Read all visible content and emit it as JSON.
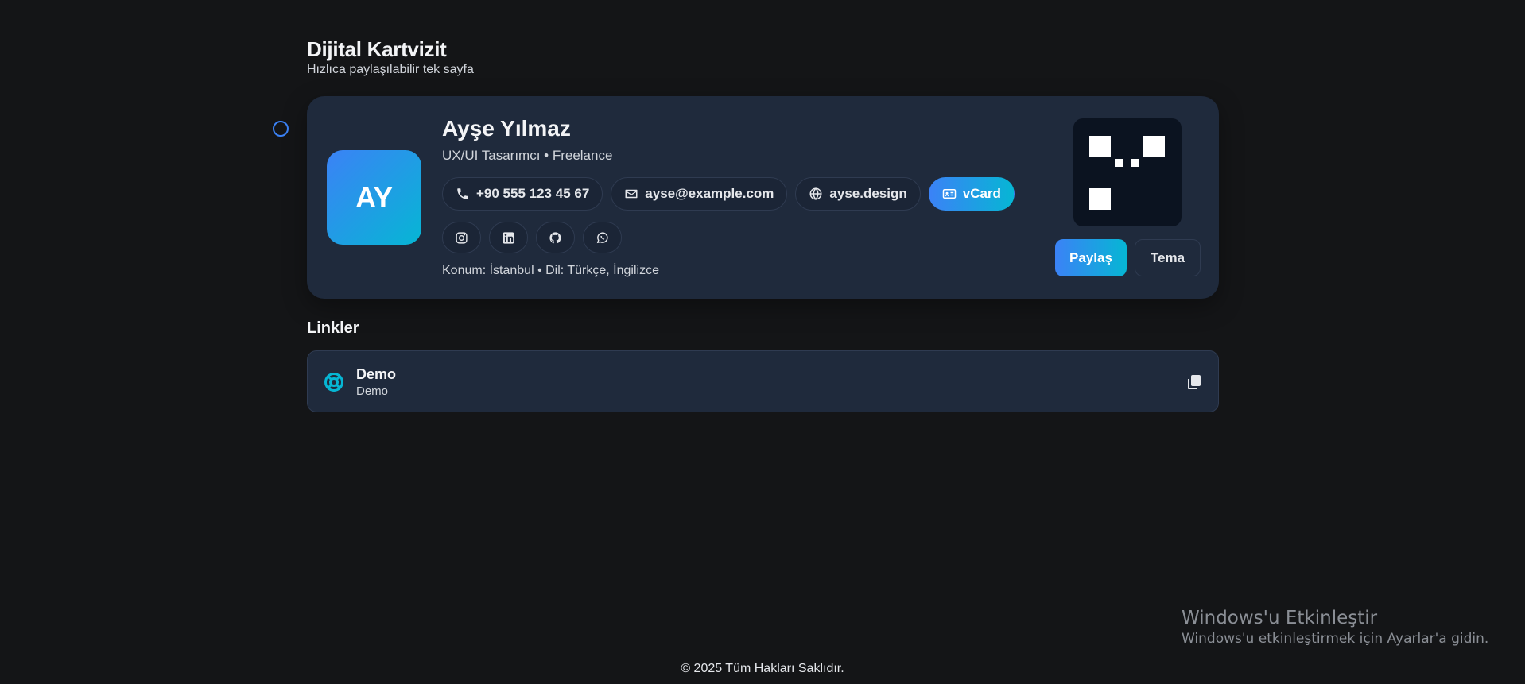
{
  "header": {
    "title": "Dijital Kartvizit",
    "subtitle": "Hızlıca paylaşılabilir tek sayfa"
  },
  "profile": {
    "initials": "AY",
    "name": "Ayşe Yılmaz",
    "role": "UX/UI Tasarımcı • Freelance",
    "contacts": {
      "phone": "+90 555 123 45 67",
      "email": "ayse@example.com",
      "website": "ayse.design",
      "vcard": "vCard"
    },
    "social_icons": [
      "instagram-icon",
      "linkedin-icon",
      "github-icon",
      "whatsapp-icon"
    ],
    "meta": "Konum: İstanbul • Dil: Türkçe, İngilizce",
    "actions": {
      "share_label": "Paylaş",
      "theme_label": "Tema"
    }
  },
  "links": {
    "heading": "Linkler",
    "items": [
      {
        "title": "Demo",
        "subtitle": "Demo",
        "icon": "lifebuoy-icon",
        "action_icon": "copy-icon"
      }
    ]
  },
  "os_overlay": {
    "title": "Windows'u Etkinleştir",
    "subtitle": "Windows'u etkinleştirmek için Ayarlar'a gidin."
  },
  "footer": {
    "copyright": "© 2025 Tüm Hakları Saklıdır."
  },
  "colors": {
    "background": "#141517",
    "card": "#1f2a3c",
    "accent_start": "#3b82f6",
    "accent_end": "#06b6d4",
    "border": "#2f3b51"
  }
}
